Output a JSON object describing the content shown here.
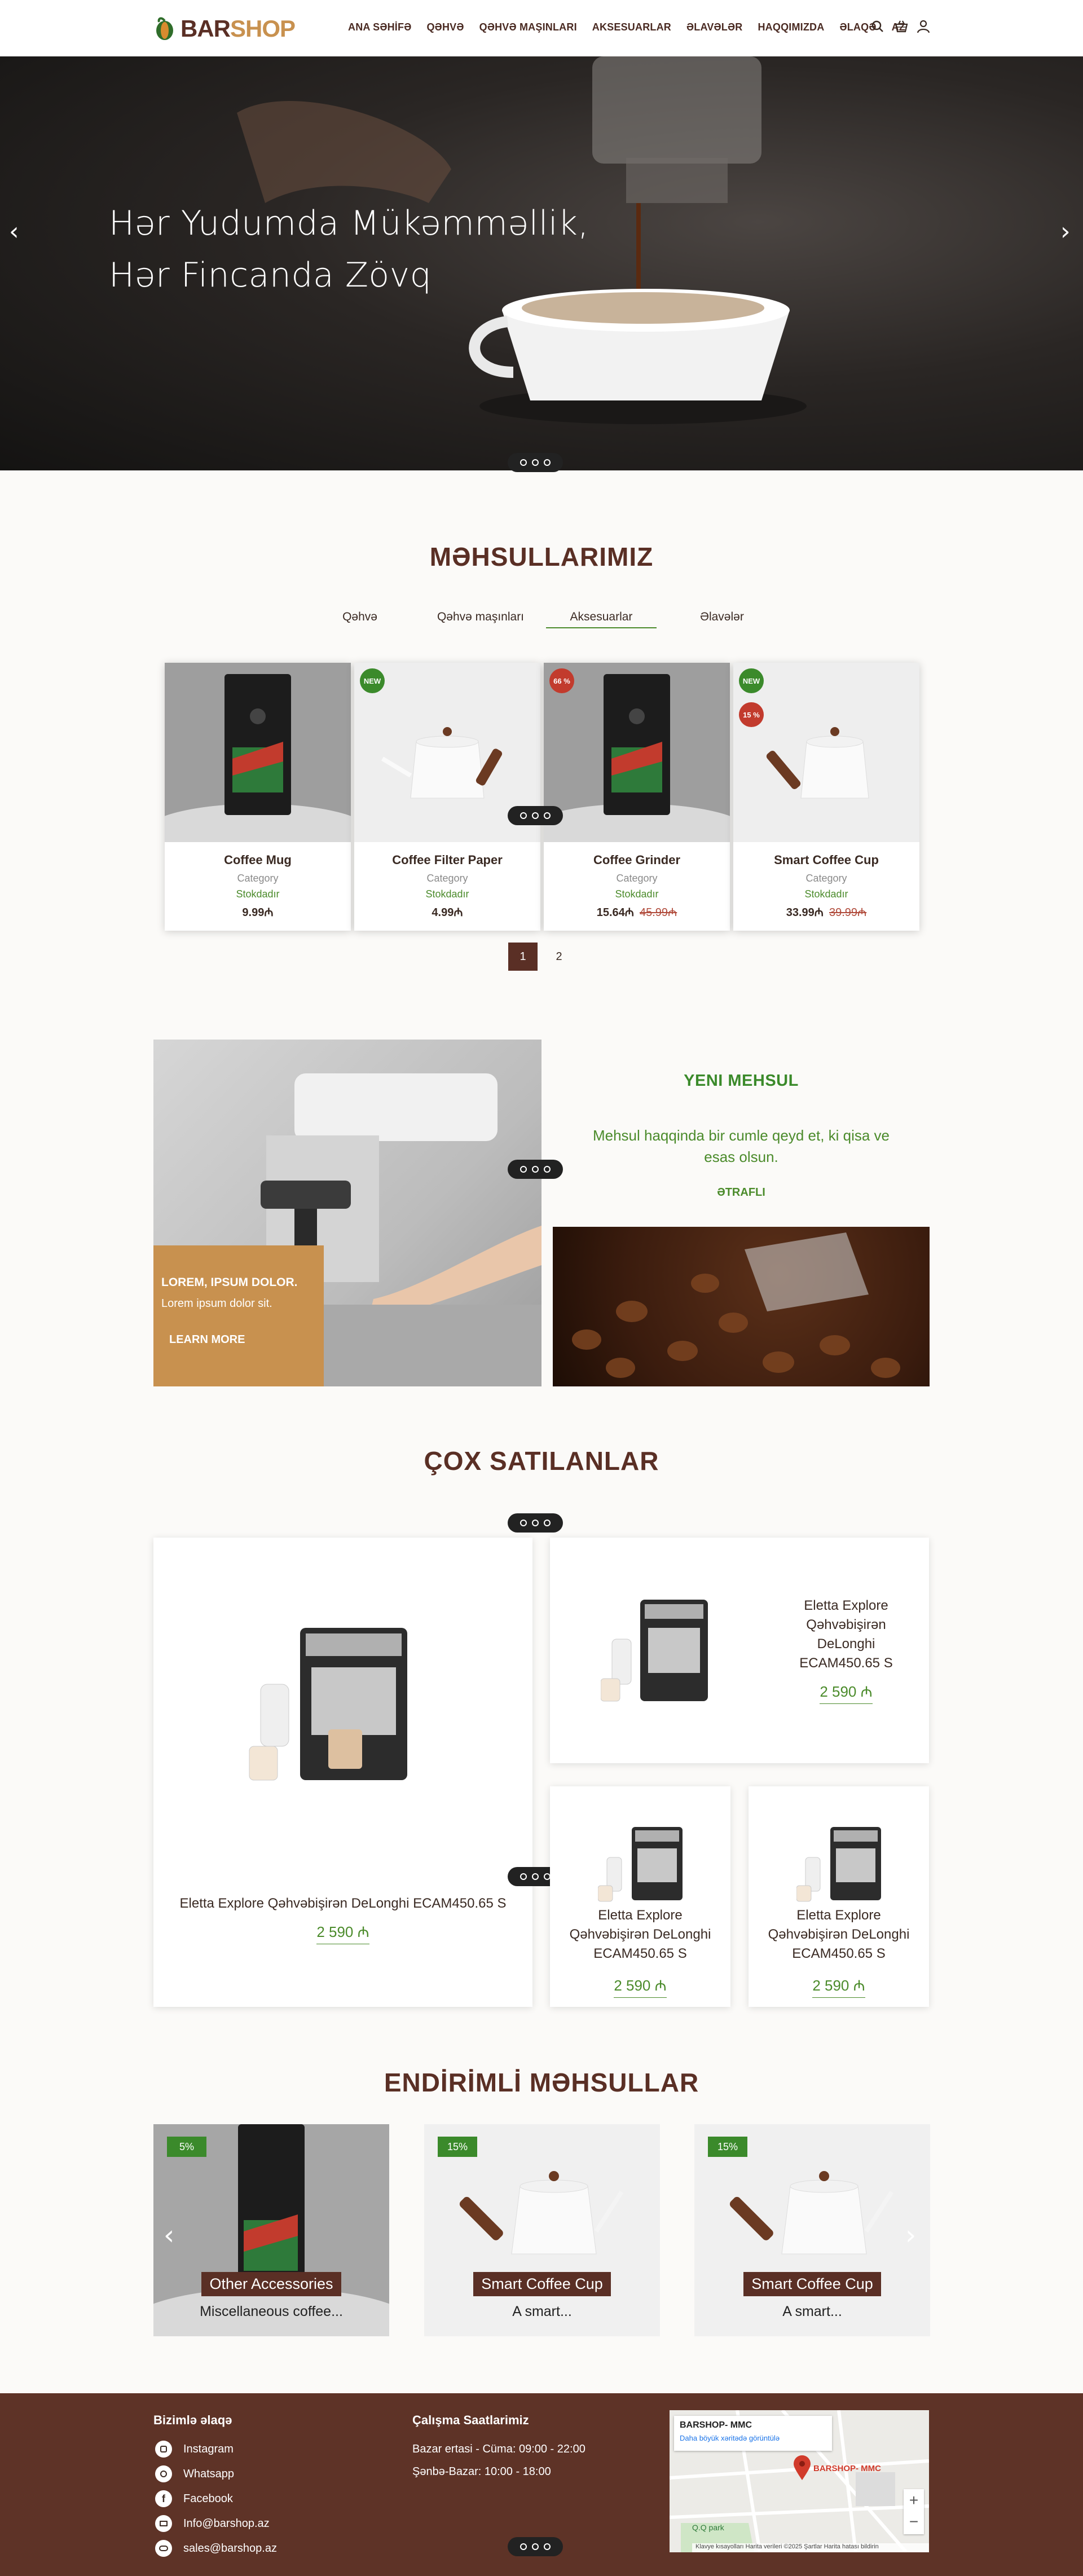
{
  "header": {
    "logo": {
      "bar": "BAR",
      "shop": "SHOP"
    },
    "nav": [
      "ANA SƏHİFƏ",
      "QƏHVƏ",
      "QƏHVƏ MAŞINLARI",
      "AKSESUARLAR",
      "ƏLAVƏLƏR",
      "HAQQIMIZDA",
      "ƏLAQƏ",
      "AZ"
    ],
    "icons": [
      "search-icon",
      "basket-icon",
      "user-icon"
    ]
  },
  "hero": {
    "line1": "Hər Yudumda Mükəmməllik,",
    "line2": "Hər Fincanda Zövq",
    "prev": "‹",
    "next": "›"
  },
  "products": {
    "title": "MƏHSULLARIMIZ",
    "tabs": [
      "Qəhvə",
      "Qəhvə maşınları",
      "Aksesuarlar",
      "Əlavələr"
    ],
    "active_tab": "Aksesuarlar",
    "items": [
      {
        "name": "Coffee Mug",
        "category": "Category",
        "stock": "Stokdadır",
        "price": "9.99₼",
        "old": "",
        "badge": "",
        "badge2": ""
      },
      {
        "name": "Coffee Filter Paper",
        "category": "Category",
        "stock": "Stokdadır",
        "price": "4.99₼",
        "old": "",
        "badge": "NEW",
        "badge2": ""
      },
      {
        "name": "Coffee Grinder",
        "category": "Category",
        "stock": "Stokdadır",
        "price": "15.64₼",
        "old": "45.99₼",
        "badge": "66 %",
        "badge2": ""
      },
      {
        "name": "Smart Coffee Cup",
        "category": "Category",
        "stock": "Stokdadır",
        "price": "33.99₼",
        "old": "39.99₼",
        "badge": "NEW",
        "badge2": "15 %"
      }
    ],
    "pages": [
      "1",
      "2"
    ],
    "current_page": "1"
  },
  "promo": {
    "box_title": "LOREM, IPSUM DOLOR.",
    "box_text": "Lorem ipsum dolor sit.",
    "box_link": "LEARN MORE",
    "new_title": "YENI MEHSUL",
    "new_text": "Mehsul haqqinda bir cumle qeyd et, ki qisa ve esas olsun.",
    "new_link": "ƏTRAFLI"
  },
  "bestsellers": {
    "title": "ÇOX SATILANLAR",
    "big": {
      "name": "Eletta Explore Qəhvəbişirən DeLonghi ECAM450.65 S",
      "price": "2 590 ₼"
    },
    "items": [
      {
        "name": "Eletta Explore Qəhvəbişirən DeLonghi ECAM450.65 S",
        "price": "2 590 ₼"
      },
      {
        "name": "Eletta Explore Qəhvəbişirən DeLonghi ECAM450.65 S",
        "price": "2 590 ₼"
      },
      {
        "name": "Eletta Explore Qəhvəbişirən DeLonghi ECAM450.65 S",
        "price": "2 590 ₼"
      }
    ]
  },
  "discounts": {
    "title": "ENDİRİMLİ MƏHSULLAR",
    "items": [
      {
        "badge": "5%",
        "label": "Other Accessories",
        "desc": "Miscellaneous coffee..."
      },
      {
        "badge": "15%",
        "label": "Smart Coffee Cup",
        "desc": "A smart..."
      },
      {
        "badge": "15%",
        "label": "Smart Coffee Cup",
        "desc": "A smart..."
      }
    ],
    "prev": "‹",
    "next": "›"
  },
  "footer": {
    "contact_title": "Bizimlə əlaqə",
    "contacts": [
      {
        "icon": "instagram-icon",
        "label": "Instagram"
      },
      {
        "icon": "whatsapp-icon",
        "label": "Whatsapp"
      },
      {
        "icon": "facebook-icon",
        "label": "Facebook"
      },
      {
        "icon": "mail-icon",
        "label": "Info@barshop.az"
      },
      {
        "icon": "cloud-mail-icon",
        "label": "sales@barshop.az"
      }
    ],
    "hours_title": "Çalışma Saatlarimiz",
    "hours": [
      "Bazar ertasi - Cüma: 09:00 - 22:00",
      "Şənbə-Bazar: 10:00 - 18:00"
    ],
    "map": {
      "place": "BARSHOP- MMC",
      "link": "Daha böyük xəritədə görüntülə",
      "pin": "BARSHOP- MMC",
      "park": "Q.Q park",
      "footer": "Klavye kısayolları   Harita verileri ©2025   Şartlar   Harita hatası bildirin"
    }
  },
  "colors": {
    "brand_brown": "#5a2f25",
    "accent_green": "#4b8b2b",
    "promo_tan": "#c8914f",
    "footer_bg": "#5e3327"
  }
}
